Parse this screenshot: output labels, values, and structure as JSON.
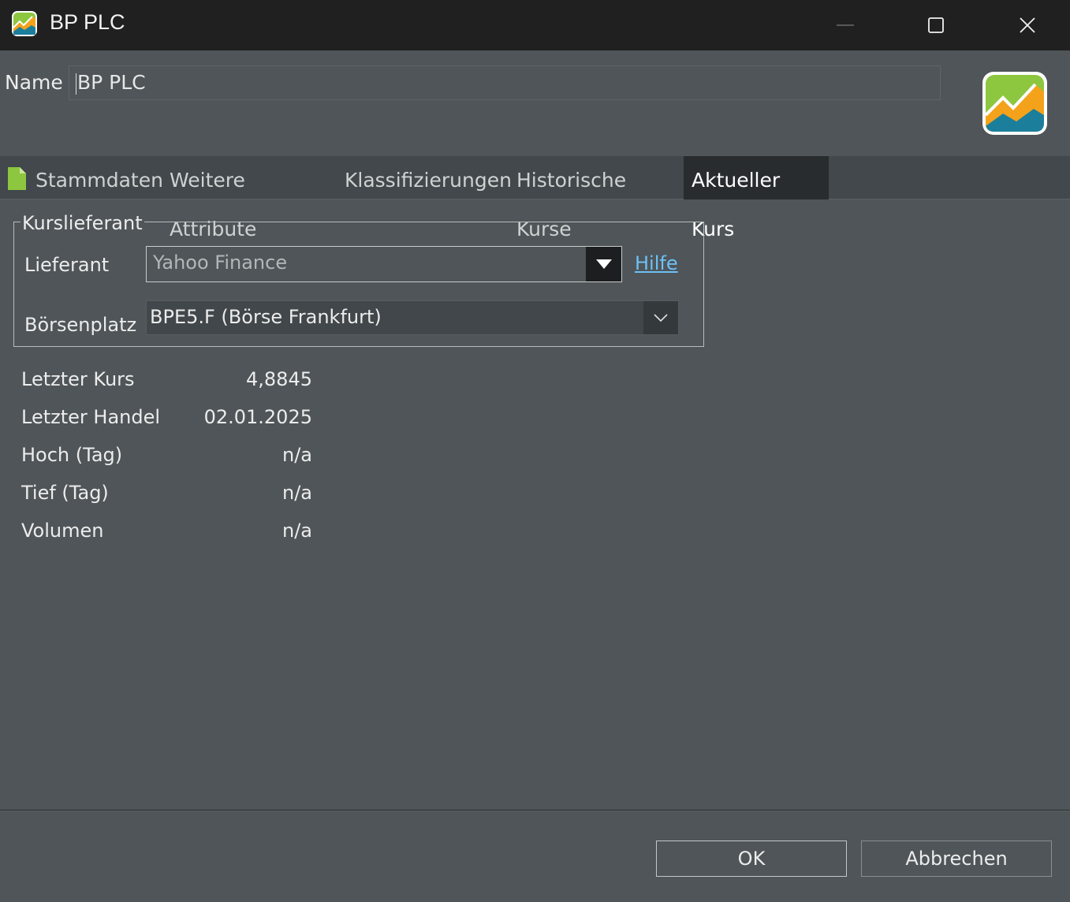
{
  "window": {
    "title": "BP PLC",
    "icon": "app-chart-icon"
  },
  "name_field": {
    "label": "Name",
    "value": "BP PLC"
  },
  "tabs": [
    {
      "label": "Stammdaten",
      "icon": "document-icon",
      "active": false
    },
    {
      "label": "Weitere Attribute",
      "active": false
    },
    {
      "label": "Klassifizierungen",
      "active": false
    },
    {
      "label": "Historische Kurse",
      "active": false
    },
    {
      "label": "Aktueller Kurs",
      "active": true
    }
  ],
  "kurslieferant": {
    "legend": "Kurslieferant",
    "provider_label": "Lieferant",
    "provider_value": "Yahoo Finance",
    "help_link": "Hilfe",
    "exchange_label": "Börsenplatz",
    "exchange_value": "BPE5.F (Börse Frankfurt)"
  },
  "quote": [
    {
      "label": "Letzter Kurs",
      "value": "4,8845"
    },
    {
      "label": "Letzter Handel",
      "value": "02.01.2025"
    },
    {
      "label": "Hoch (Tag)",
      "value": "n/a"
    },
    {
      "label": "Tief (Tag)",
      "value": "n/a"
    },
    {
      "label": "Volumen",
      "value": "n/a"
    }
  ],
  "buttons": {
    "ok": "OK",
    "cancel": "Abbrechen"
  },
  "colors": {
    "background": "#4f5558",
    "titlebar": "#202020",
    "active_tab": "#292c2e",
    "link": "#6ec0f5",
    "logo_green": "#8dc63f",
    "logo_orange": "#f5a21b",
    "logo_teal": "#1b7f9c"
  }
}
